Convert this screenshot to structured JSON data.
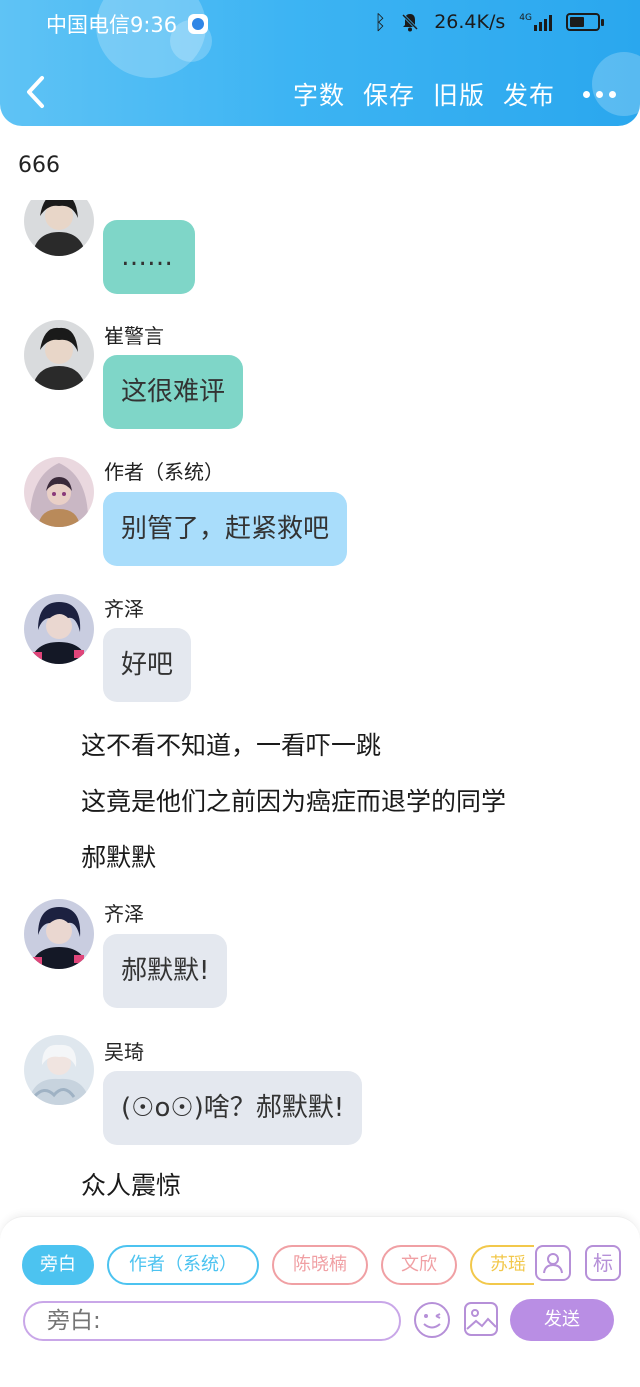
{
  "status": {
    "carrier": "中国电信",
    "time": "9:36",
    "network_speed": "26.4K/s",
    "signal": "4G",
    "battery_percent": 55
  },
  "header": {
    "menu": [
      "字数",
      "保存",
      "旧版",
      "发布"
    ]
  },
  "word_count": "666",
  "messages": [
    {
      "type": "bubble",
      "name": "",
      "text": "……",
      "bubble_color": "#7fd6c8",
      "avatar": "dark-hair-boy"
    },
    {
      "type": "bubble",
      "name": "崔警言",
      "text": "这很难评",
      "bubble_color": "#7fd6c8",
      "avatar": "dark-hair-boy"
    },
    {
      "type": "bubble",
      "name": "作者（系统）",
      "text": "别管了，赶紧救吧",
      "bubble_color": "#a9ddfb",
      "avatar": "hooded-girl"
    },
    {
      "type": "bubble",
      "name": "齐泽",
      "text": "好吧",
      "bubble_color": "#e4e8ef",
      "avatar": "navy-hair-boy"
    },
    {
      "type": "narration",
      "text": "这不看不知道，一看吓一跳"
    },
    {
      "type": "narration",
      "text": "这竟是他们之前因为癌症而退学的同学"
    },
    {
      "type": "narration",
      "text": "郝默默"
    },
    {
      "type": "bubble",
      "name": "齐泽",
      "text": "郝默默!",
      "bubble_color": "#e4e8ef",
      "avatar": "navy-hair-boy"
    },
    {
      "type": "bubble",
      "name": "吴琦",
      "text": "(☉o☉)啥？郝默默!",
      "bubble_color": "#e4e8ef",
      "avatar": "white-hair-boy"
    },
    {
      "type": "narration",
      "text": "众人震惊"
    }
  ],
  "chips": [
    {
      "label": "旁白",
      "color": "#4cc3f0",
      "filled": true
    },
    {
      "label": "作者（系统）",
      "color": "#4cc3f0",
      "filled": false
    },
    {
      "label": "陈晓楠",
      "color": "#f0a0a4",
      "filled": false
    },
    {
      "label": "文欣",
      "color": "#f0a0a4",
      "filled": false
    },
    {
      "label": "苏瑶",
      "color": "#f2c84b",
      "filled": false
    }
  ],
  "tools": {
    "label_btn": "标"
  },
  "input": {
    "placeholder": "旁白:"
  },
  "send_label": "发送"
}
